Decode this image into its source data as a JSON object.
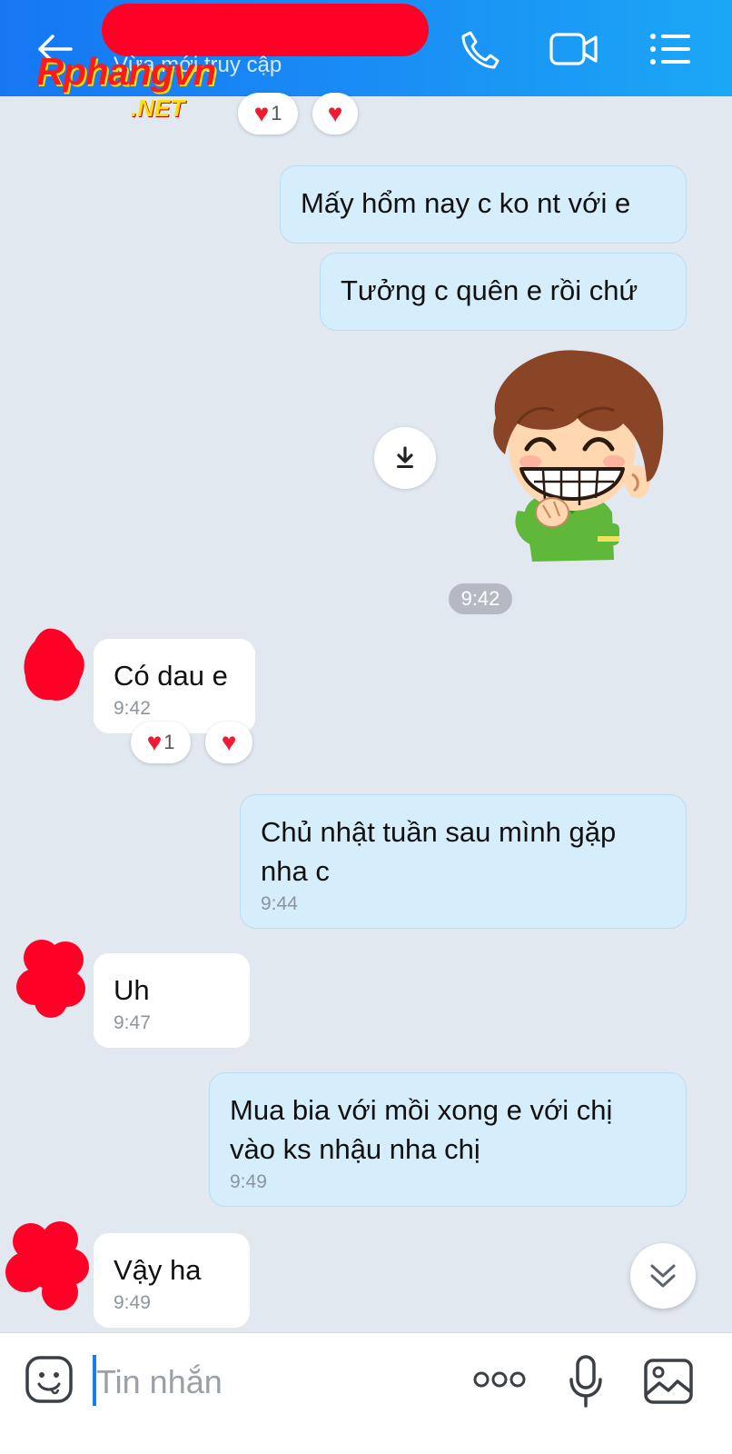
{
  "header": {
    "subtitle": "Vừa mới truy cập",
    "back_icon": "arrow-left-icon",
    "call_icon": "phone-icon",
    "video_icon": "video-camera-icon",
    "menu_icon": "list-menu-icon",
    "background": "#1a8ff5"
  },
  "watermark": {
    "main": "Rphangvn",
    "sub": ".NET"
  },
  "top_reactions": {
    "count": "1"
  },
  "messages": [
    {
      "text": "Mấy hổm nay c ko nt với e"
    },
    {
      "text": "Tưởng c quên e rồi chứ"
    },
    {
      "text": "Có dau e",
      "time": "9:42",
      "reaction_count": "1"
    },
    {
      "lines": [
        "Chủ nhật tuần sau mình gặp",
        "nha c"
      ],
      "time": "9:44"
    },
    {
      "text": "Uh",
      "time": "9:47"
    },
    {
      "lines": [
        "Mua bia với mồi xong e với chị",
        "vào ks nhậu nha chị"
      ],
      "time": "9:49"
    },
    {
      "text": "Vậy ha",
      "time": "9:49"
    }
  ],
  "sticker": {
    "time": "9:42",
    "download_icon": "download-icon"
  },
  "composer": {
    "placeholder": "Tin nhắn",
    "emoji_icon": "emoji-icon",
    "more_icon": "more-dots-icon",
    "mic_icon": "microphone-icon",
    "image_icon": "image-icon"
  },
  "scroll_down_icon": "double-chevron-down-icon",
  "colors": {
    "outgoing_bubble": "#d6edfc",
    "incoming_bubble": "#ffffff",
    "heart": "#ee1c32",
    "background": "#e2e8f0"
  }
}
